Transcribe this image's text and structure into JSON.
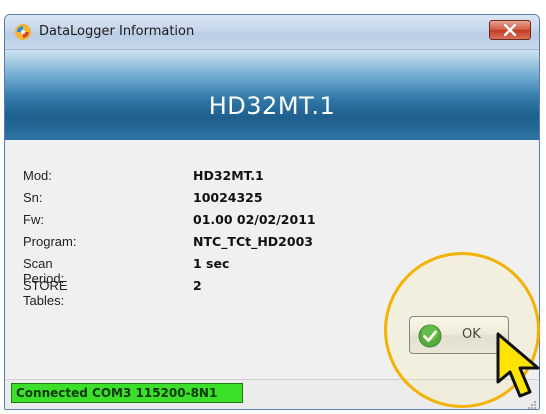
{
  "window": {
    "title": "DataLogger Information",
    "close_icon": "close-icon",
    "app_icon": "datalogger-app-icon"
  },
  "banner": {
    "title": "HD32MT.1"
  },
  "info": {
    "rows": [
      {
        "label": "Mod:",
        "value": "HD32MT.1"
      },
      {
        "label": "Sn:",
        "value": "10024325"
      },
      {
        "label": "Fw:",
        "value": "01.00  02/02/2011"
      },
      {
        "label": "Program:",
        "value": "NTC_TCt_HD2003"
      },
      {
        "label": "Scan Period:",
        "value": "1 sec"
      },
      {
        "label": "STORE Tables:",
        "value": "2"
      }
    ]
  },
  "ok_button": {
    "label": "OK",
    "icon": "green-check-icon"
  },
  "status": {
    "connection": "Connected COM3 115200-8N1",
    "color": "#3ce02a"
  },
  "annotation": {
    "highlight_color": "#f2b200",
    "pointer_icon": "pointer-arrow-icon"
  }
}
